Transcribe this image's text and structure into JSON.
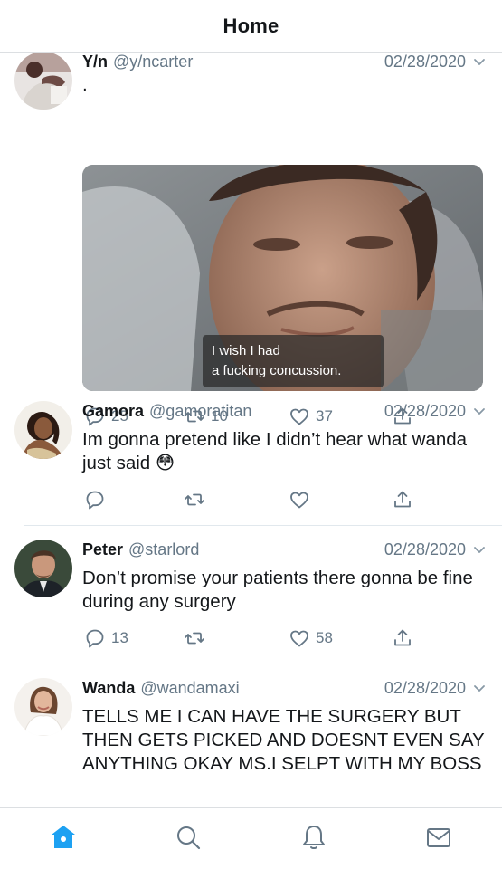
{
  "header": {
    "title": "Home"
  },
  "tweets": [
    {
      "name": "Y/n",
      "handle": "@y/ncarter",
      "date": "02/28/2020",
      "text": ".",
      "media_caption": [
        "I wish I had",
        "a fucking concussion."
      ],
      "replies": "25",
      "retweets": "10",
      "likes": "37"
    },
    {
      "name": "Gamora",
      "handle": "@gamoratitan",
      "date": "02/28/2020",
      "text": "Im gonna pretend like I didn’t hear what wanda just said 😳",
      "replies": "",
      "retweets": "",
      "likes": ""
    },
    {
      "name": "Peter",
      "handle": "@starlord",
      "date": "02/28/2020",
      "text": "Don’t promise your patients there gonna be fine during any surgery",
      "replies": "13",
      "retweets": "",
      "likes": "58"
    },
    {
      "name": "Wanda",
      "handle": "@wandamaxi",
      "date": "02/28/2020",
      "text": "TELLS ME I CAN HAVE THE SURGERY BUT THEN GETS PICKED AND DOESNT EVEN SAY ANYTHING OKAY MS.I SELPT WITH MY BOSS"
    }
  ],
  "tabbar": {
    "items": [
      {
        "icon": "home-icon",
        "active": true
      },
      {
        "icon": "search-icon",
        "active": false
      },
      {
        "icon": "bell-icon",
        "active": false
      },
      {
        "icon": "mail-icon",
        "active": false
      }
    ]
  },
  "colors": {
    "accent": "#1da1f2",
    "secondary_text": "#657786",
    "divider": "#e1e8ed"
  }
}
